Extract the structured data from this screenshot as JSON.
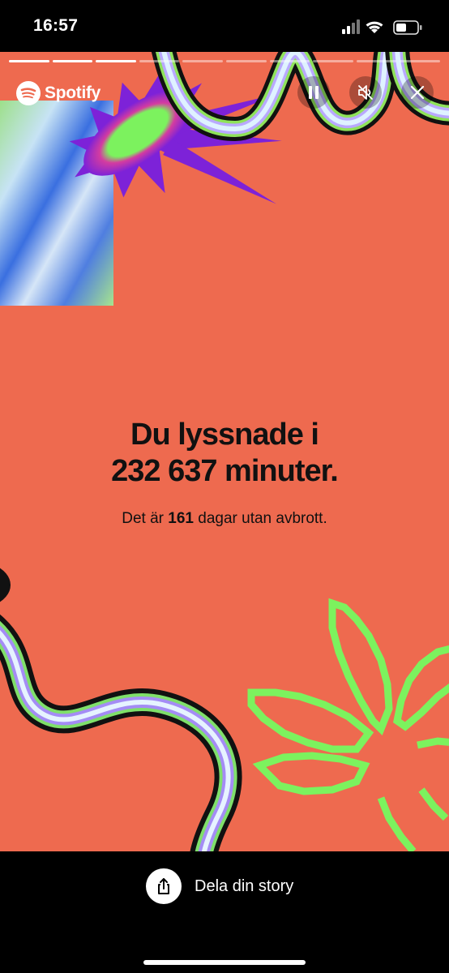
{
  "status_bar": {
    "time": "16:57",
    "battery_icon": "battery-icon",
    "wifi_icon": "wifi-icon",
    "signal_icon": "signal-icon"
  },
  "story": {
    "brand": "Spotify",
    "progress_segments_total": 10,
    "progress_segments_done": 3,
    "headline_line1": "Du lyssnade i",
    "headline_line2": "232 637 minuter.",
    "sub_prefix": "Det är ",
    "sub_days": "161",
    "sub_suffix": " dagar utan avbrott.",
    "controls": {
      "pause_icon": "pause-icon",
      "mute_icon": "speaker-mute-icon",
      "close_icon": "close-icon"
    },
    "colors": {
      "background": "#EE6A4F",
      "accent_green": "#7CF25E",
      "accent_purple": "#8A2BE2"
    }
  },
  "bottom_bar": {
    "share_label": "Dela din story",
    "share_icon": "share-icon"
  }
}
